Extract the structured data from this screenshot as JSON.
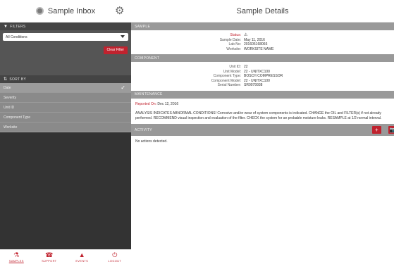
{
  "sidebar": {
    "title": "Sample Inbox",
    "filters_label": "FILTERS",
    "filter_select_value": "All Conditions",
    "clear_filter_label": "Clear Filter",
    "sort_label": "SORT BY",
    "sort_items": [
      {
        "label": "Date",
        "selected": true
      },
      {
        "label": "Severity",
        "selected": false
      },
      {
        "label": "Unit ID",
        "selected": false
      },
      {
        "label": "Component Type",
        "selected": false
      },
      {
        "label": "Worksite",
        "selected": false
      }
    ]
  },
  "bottom_nav": [
    {
      "label": "SAMPLES",
      "icon": "flask-icon"
    },
    {
      "label": "SUPPORT",
      "icon": "phone-icon"
    },
    {
      "label": "EVENTS",
      "icon": "bell-icon"
    },
    {
      "label": "LOGOUT",
      "icon": "power-icon"
    }
  ],
  "details": {
    "title": "Sample Details",
    "sample_section": "SAMPLE",
    "sample_fields": [
      {
        "k": "Status:",
        "v": "⚠"
      },
      {
        "k": "Sample Date:",
        "v": "May 11, 2016"
      },
      {
        "k": "Lab No:",
        "v": "201605168066"
      },
      {
        "k": "Worksite:",
        "v": "WORKSITE NAME"
      }
    ],
    "component_section": "COMPONENT",
    "component_fields": [
      {
        "k": "Unit ID:",
        "v": "22"
      },
      {
        "k": "Unit Model:",
        "v": "22 - UNITXC100"
      },
      {
        "k": "Component Type:",
        "v": "BOSCH COMPRESSOR"
      },
      {
        "k": "Component Model:",
        "v": "22 - UNITXC100"
      },
      {
        "k": "Serial Number:",
        "v": "SR0079938"
      }
    ],
    "maintenance_section": "MAINTENANCE",
    "reported_on_label": "Reported On:",
    "reported_on_date": "Dec 12, 2016",
    "maintenance_text": "ANALYSIS INDICATES ABNORMAL CONDITIONS! Corrosive and/or wear of system components is indicated. CHANGE the OIL and FILTER(s) if not already performed. RECOMMEND visual inspection and evaluation of the filter. CHECK the system for an probable moisture leaks. RESAMPLE at 1/2 normal interval.",
    "activity_section": "ACTIVITY",
    "add_label": "+",
    "camera_label": "📷",
    "no_actions": "No actions detected."
  }
}
